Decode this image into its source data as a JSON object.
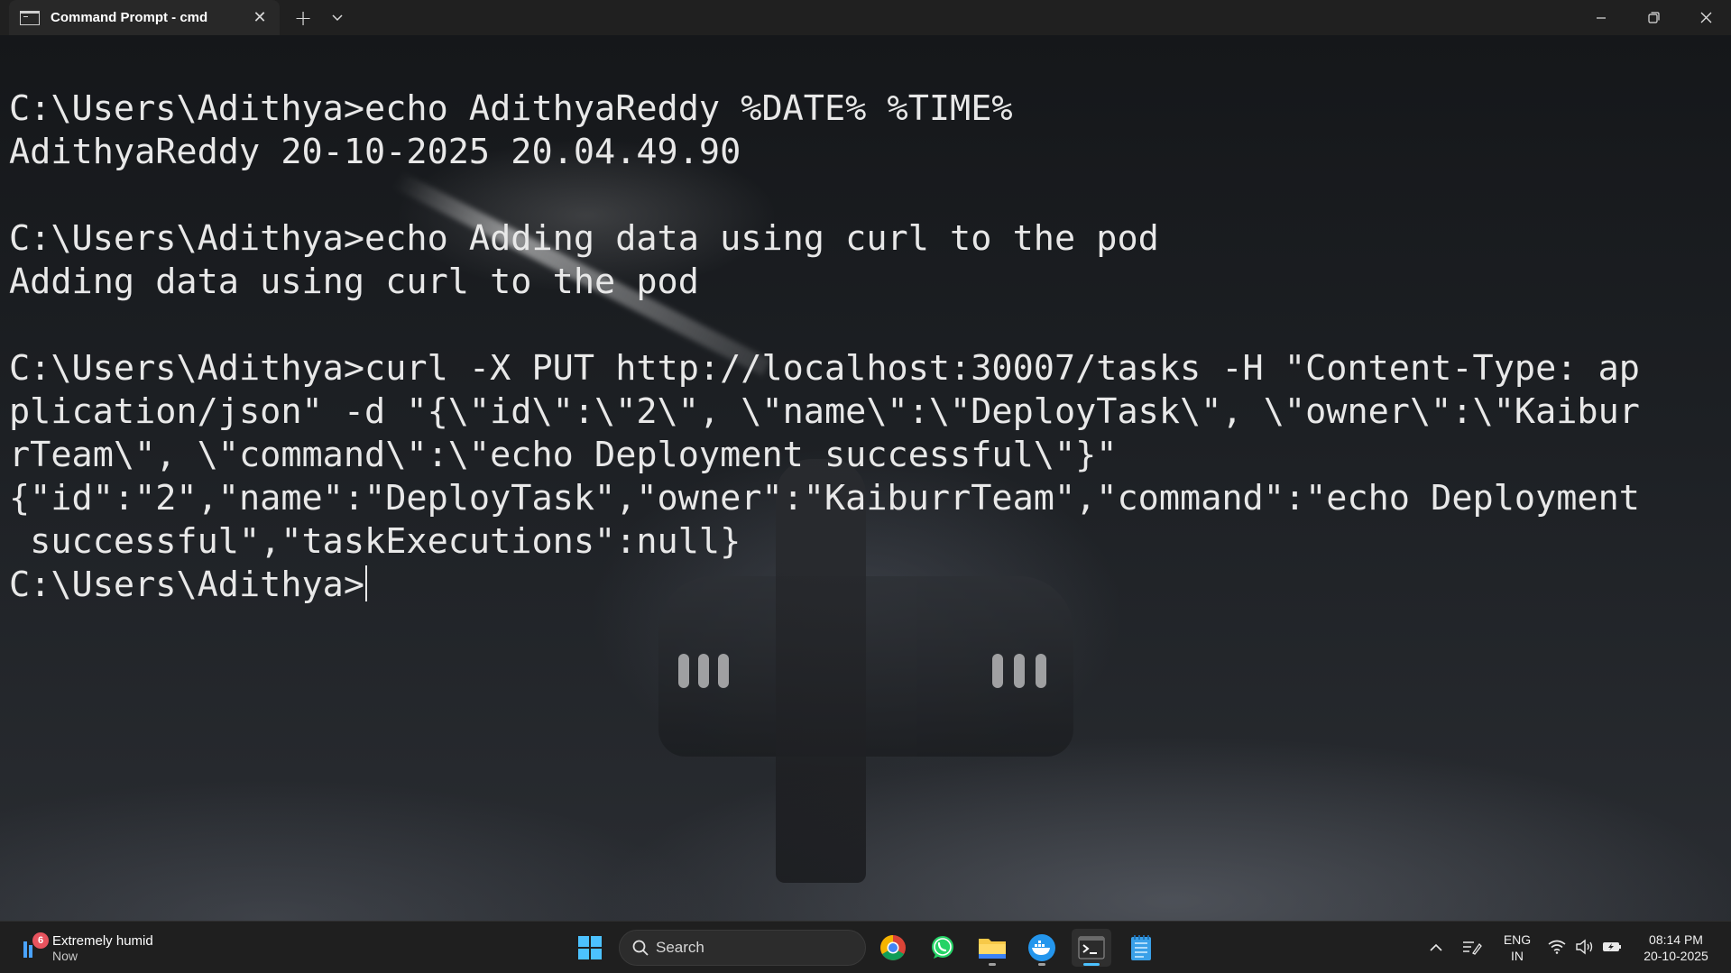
{
  "window": {
    "tab_title": "Command Prompt - cmd",
    "tab_close_glyph": "✕",
    "new_tab_glyph": "+",
    "dropdown_icon": "chevron-down-icon",
    "controls": [
      "minimize-icon",
      "restore-icon",
      "close-icon"
    ]
  },
  "terminal": {
    "lines": [
      "C:\\Users\\Adithya>echo AdithyaReddy %DATE% %TIME%",
      "AdithyaReddy 20-10-2025 20.04.49.90",
      "",
      "C:\\Users\\Adithya>echo Adding data using curl to the pod",
      "Adding data using curl to the pod",
      "",
      "C:\\Users\\Adithya>curl -X PUT http://localhost:30007/tasks -H \"Content-Type: ap",
      "plication/json\" -d \"{\\\"id\\\":\\\"2\\\", \\\"name\\\":\\\"DeployTask\\\", \\\"owner\\\":\\\"Kaibur",
      "rTeam\\\", \\\"command\\\":\\\"echo Deployment successful\\\"}\"",
      "{\"id\":\"2\",\"name\":\"DeployTask\",\"owner\":\"KaiburrTeam\",\"command\":\"echo Deployment",
      " successful\",\"taskExecutions\":null}"
    ],
    "prompt": "C:\\Users\\Adithya>",
    "colors": {
      "text": "#e8e8e8",
      "background": "#1c1e21"
    }
  },
  "taskbar": {
    "weather": {
      "badge": "6",
      "condition": "Extremely humid",
      "time": "Now"
    },
    "search_placeholder": "Search",
    "pinned": [
      "windows-start-icon",
      "chrome-icon",
      "whatsapp-icon",
      "file-explorer-icon",
      "docker-icon",
      "terminal-icon",
      "notepad-icon"
    ],
    "tray": {
      "lang_top": "ENG",
      "lang_bottom": "IN",
      "time": "08:14 PM",
      "date": "20-10-2025"
    },
    "accent": "#4cc2ff"
  }
}
